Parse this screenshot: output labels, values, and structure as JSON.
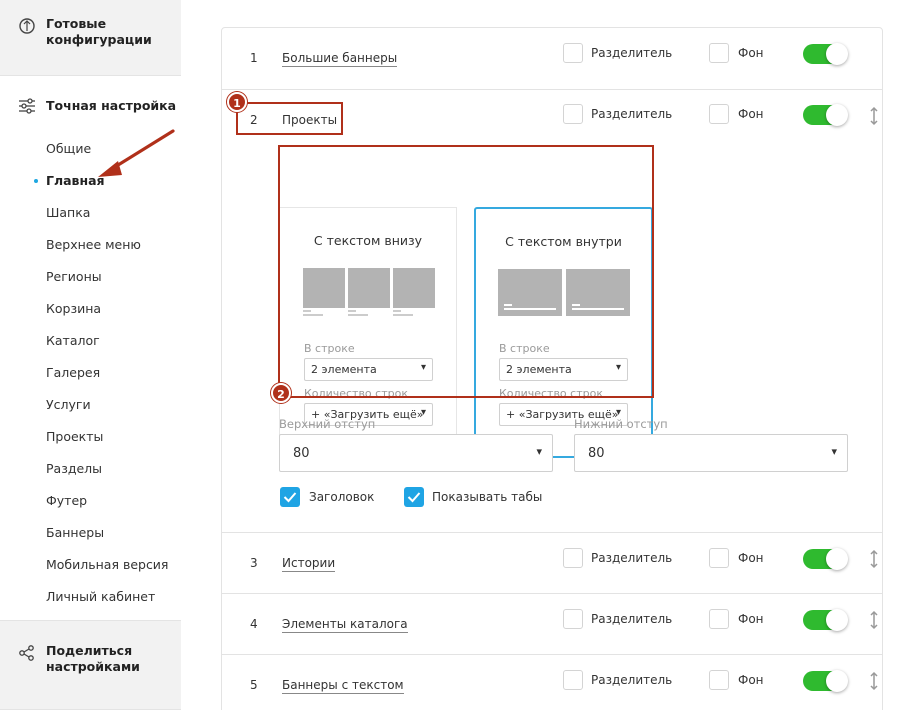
{
  "sidebar": {
    "ready_configs": "Готовые конфигурации",
    "fine_tuning": "Точная настройка",
    "share": "Поделиться настройками",
    "items": [
      {
        "label": "Общие"
      },
      {
        "label": "Главная"
      },
      {
        "label": "Шапка"
      },
      {
        "label": "Верхнее меню"
      },
      {
        "label": "Регионы"
      },
      {
        "label": "Корзина"
      },
      {
        "label": "Каталог"
      },
      {
        "label": "Галерея"
      },
      {
        "label": "Услуги"
      },
      {
        "label": "Проекты"
      },
      {
        "label": "Разделы"
      },
      {
        "label": "Футер"
      },
      {
        "label": "Баннеры"
      },
      {
        "label": "Мобильная версия"
      },
      {
        "label": "Личный кабинет"
      }
    ],
    "active_item": "Главная"
  },
  "labels": {
    "divider": "Разделитель",
    "background": "Фон"
  },
  "rows": [
    {
      "num": "1",
      "name": "Большие баннеры"
    },
    {
      "num": "2",
      "name": "Проекты"
    },
    {
      "num": "3",
      "name": "Истории"
    },
    {
      "num": "4",
      "name": "Элементы каталога"
    },
    {
      "num": "5",
      "name": "Баннеры с текстом"
    }
  ],
  "expanded": {
    "variants": [
      {
        "title": "С текстом внизу",
        "per_row_label": "В строке",
        "per_row_value": "2 элемента",
        "rows_label": "Количество строк",
        "rows_value": "+ «Загрузить ещё»"
      },
      {
        "title": "С текстом внутри",
        "per_row_label": "В строке",
        "per_row_value": "2 элемента",
        "rows_label": "Количество строк",
        "rows_value": "+ «Загрузить ещё»"
      }
    ],
    "selected_variant": "С текстом внутри",
    "top_offset_label": "Верхний отступ",
    "top_offset_value": "80",
    "bottom_offset_label": "Нижний отступ",
    "bottom_offset_value": "80",
    "show_heading_label": "Заголовок",
    "show_tabs_label": "Показывать табы"
  },
  "annotations": {
    "badge1": "1",
    "badge2": "2"
  },
  "colors": {
    "accent": "#1fa4e4",
    "toggle_on": "#2fba2f",
    "annotation": "#b0301a"
  }
}
